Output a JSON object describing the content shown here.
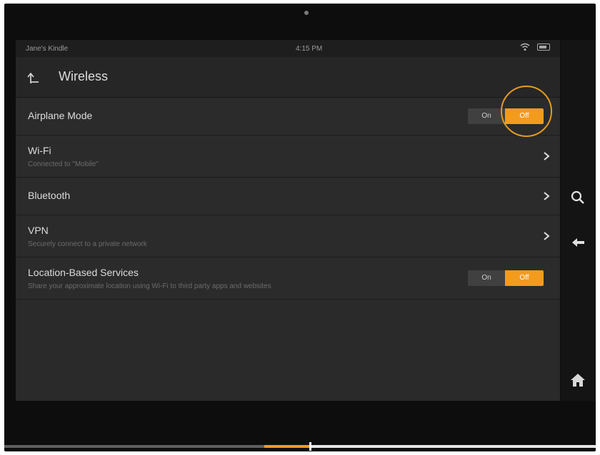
{
  "status_bar": {
    "device_name": "Jane's Kindle",
    "time": "4:15 PM"
  },
  "header": {
    "title": "Wireless"
  },
  "settings": [
    {
      "label": "Airplane Mode",
      "subtitle": "",
      "control": "toggle",
      "on_label": "On",
      "off_label": "Off",
      "value": "Off"
    },
    {
      "label": "Wi-Fi",
      "subtitle": "Connected to \"Mobile\"",
      "control": "chevron"
    },
    {
      "label": "Bluetooth",
      "subtitle": "",
      "control": "chevron"
    },
    {
      "label": "VPN",
      "subtitle": "Securely connect to a private network",
      "control": "chevron"
    },
    {
      "label": "Location-Based Services",
      "subtitle": "Share your approximate location using Wi-Fi to third party apps and websites",
      "control": "toggle",
      "on_label": "On",
      "off_label": "Off",
      "value": "Off"
    }
  ],
  "right_bar": [
    "search-icon",
    "back-arrow-icon",
    "home-icon"
  ],
  "video_progress": {
    "played_fraction": 0.52
  },
  "colors": {
    "accent": "#f39b1c",
    "background": "#2a2a2a",
    "text": "#dcdcdc"
  }
}
